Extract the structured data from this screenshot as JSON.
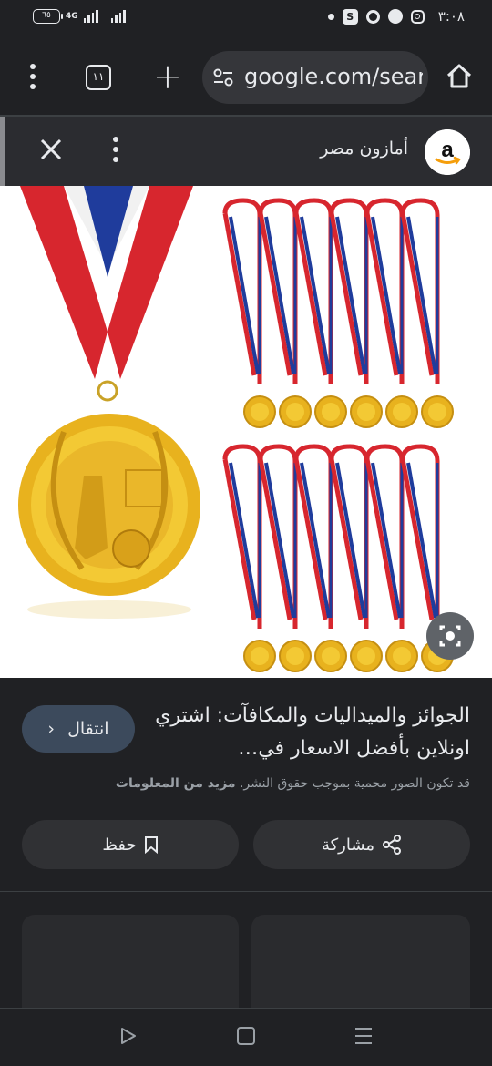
{
  "status_bar": {
    "battery": "٦٥",
    "network": "4G",
    "time": "٣:٠٨",
    "icons": [
      "dot-icon",
      "skype-icon",
      "ring-icon",
      "messenger-icon",
      "instagram-icon"
    ]
  },
  "browser": {
    "tab_count": "١١",
    "url": "google.com/sear",
    "icons": [
      "more-vert-icon",
      "tabs-icon",
      "plus-icon",
      "tune-icon",
      "home-icon"
    ]
  },
  "source": {
    "name": "أمازون مصر",
    "logo_letter": "a",
    "icons": [
      "close-icon",
      "more-vert-icon",
      "amazon-logo-icon"
    ]
  },
  "result": {
    "title": "الجوائز والميداليات والمكافآت: اشتري اونلاين بأفضل الاسعار في…",
    "visit_label": "انتقال",
    "copyright_text": "قد تكون الصور محمية بموجب حقوق النشر.",
    "learn_more": "مزيد من المعلومات",
    "share_label": "مشاركة",
    "save_label": "حفظ"
  },
  "colors": {
    "background": "#202124",
    "visit_button": "#3c4a5c",
    "button": "#303134",
    "gold": "#e8b21e",
    "ribbon_red": "#d7262e",
    "ribbon_blue": "#1f3c9c"
  }
}
